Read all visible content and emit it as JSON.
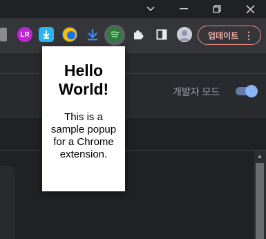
{
  "window": {
    "chevron_glyph": "⌄",
    "minimize_glyph": "—",
    "restore_glyph": "❐",
    "close_glyph": "✕"
  },
  "toolbar": {
    "extensions": [
      {
        "icon": "partial-extension-icon"
      },
      {
        "icon": "lr-extension-icon",
        "text": "LR",
        "color": "#c026d3"
      },
      {
        "icon": "download-shield-extension-icon",
        "color": "#29b6f6"
      },
      {
        "icon": "circle-extension-icon",
        "color": "#fbbc04"
      },
      {
        "icon": "download-arrow-icon",
        "color": "#4285f4"
      },
      {
        "icon": "spotify-like-extension-icon",
        "color": "#1db954"
      },
      {
        "icon": "puzzle-icon"
      },
      {
        "icon": "side-panel-icon"
      },
      {
        "icon": "profile-avatar"
      }
    ],
    "update_label": "업데이트",
    "menu_glyph": "⋮"
  },
  "popup": {
    "title": "Hello World!",
    "body": "This is a sample popup for a Chrome extension."
  },
  "page": {
    "dev_mode_label": "개발자 모드",
    "dev_mode_on": true
  }
}
